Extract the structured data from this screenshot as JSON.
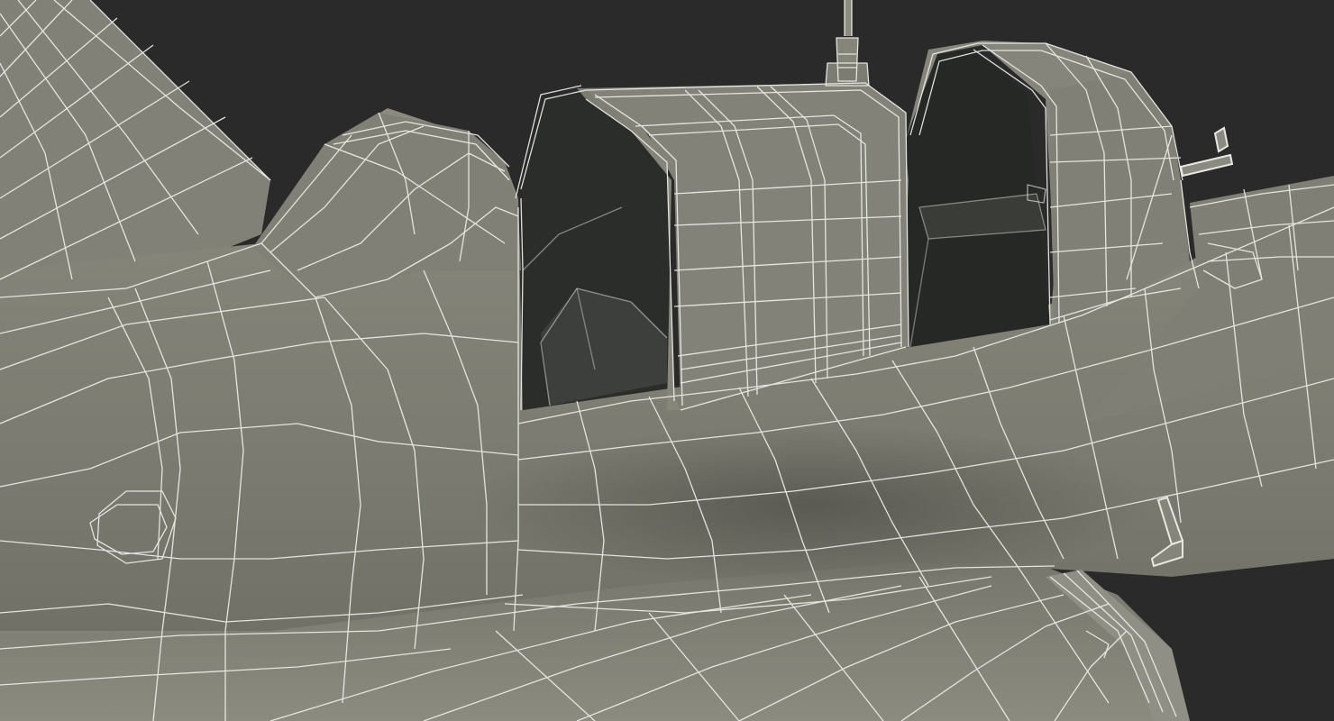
{
  "scene": {
    "subject": "wireframe-aircraft-cockpit-render",
    "colors": {
      "background": "#2a2a2a",
      "surface": "#7e7e73",
      "surface_light": "#8d8d82",
      "surface_dark": "#6a6a60",
      "wire": "#eeeeea",
      "cockpit_interior": "#262826",
      "cockpit_interior_light": "#3c3f3b"
    }
  }
}
